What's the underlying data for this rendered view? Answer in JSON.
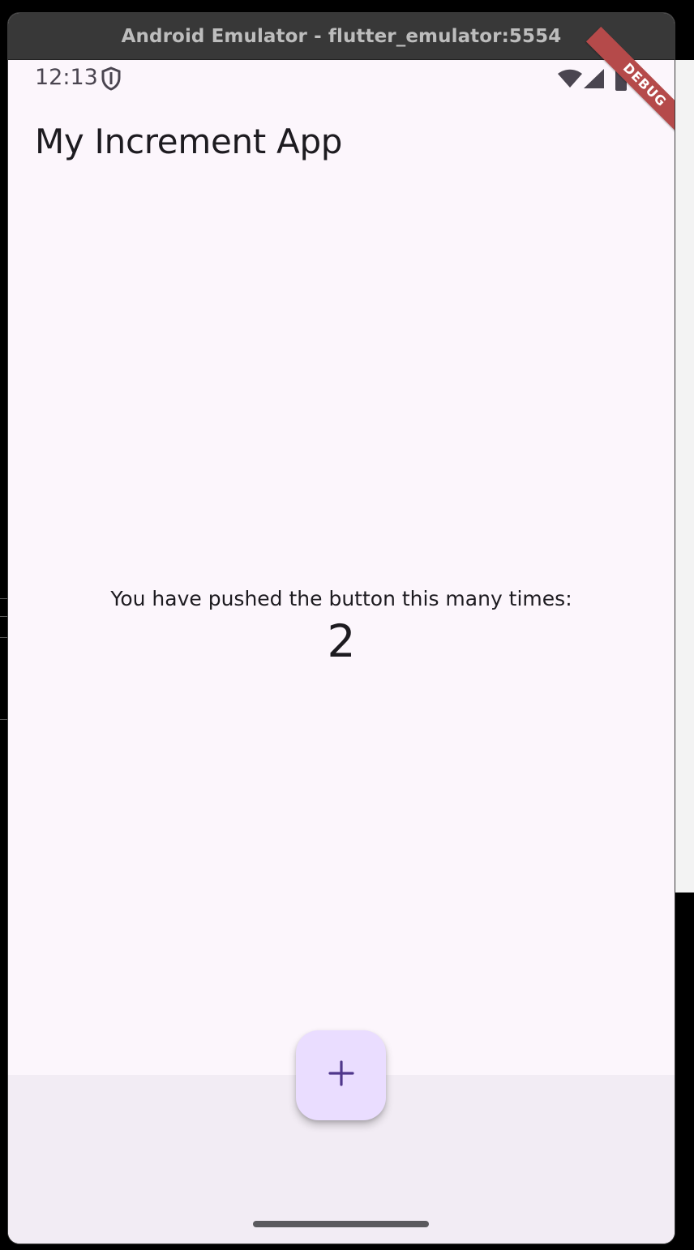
{
  "window": {
    "title": "Android Emulator - flutter_emulator:5554"
  },
  "status_bar": {
    "time": "12:13",
    "icons": [
      "shield-icon",
      "wifi-icon",
      "signal-icon",
      "battery-icon"
    ]
  },
  "debug_banner": {
    "label": "DEBUG"
  },
  "app_bar": {
    "title": "My Increment App"
  },
  "body": {
    "counter_label": "You have pushed the button this many times:",
    "counter_value": "2"
  },
  "fab": {
    "icon": "plus-icon",
    "color": "#eaddff",
    "icon_color": "#4f378b"
  },
  "colors": {
    "surface": "#fcf6fc",
    "bottom_surface": "#f2ecf4",
    "text": "#1d1b20",
    "debug_banner": "#b54a4a"
  }
}
